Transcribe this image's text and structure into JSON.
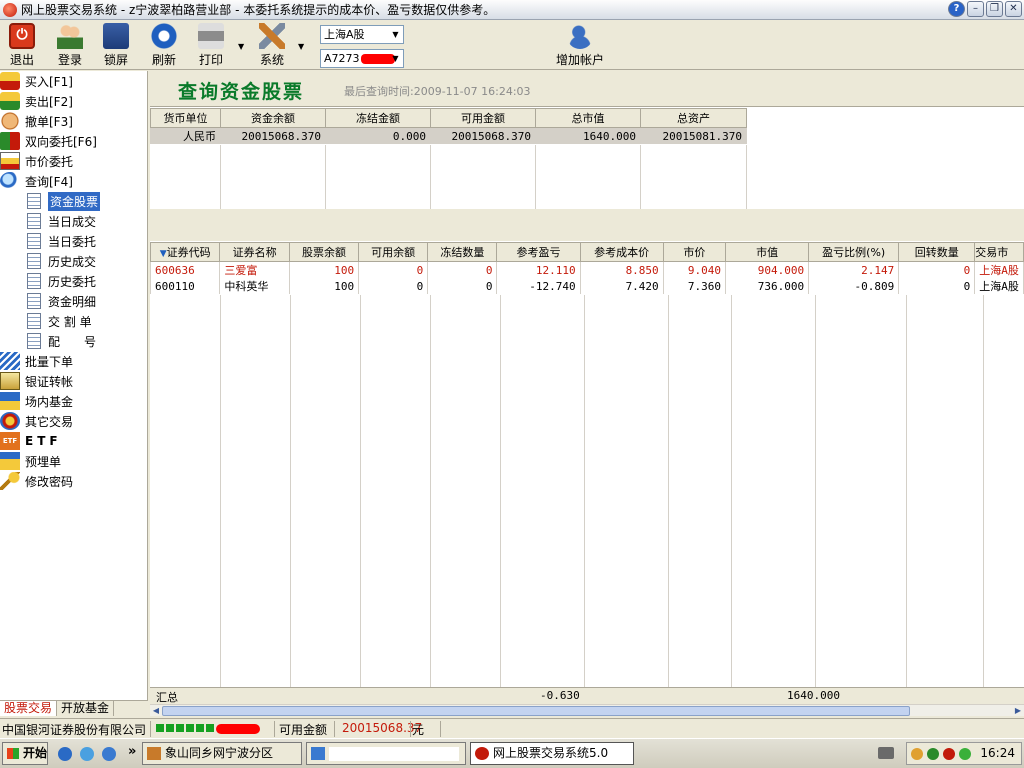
{
  "window": {
    "title": "网上股票交易系统 - z宁波翠柏路营业部 - 本委托系统提示的成本价、盈亏数据仅供参考。",
    "help_label": "?",
    "minimize_label": "–",
    "restore_label": "❐",
    "close_label": "✕"
  },
  "toolbar": {
    "exit": "退出",
    "login": "登录",
    "lock": "锁屏",
    "refresh": "刷新",
    "print": "打印",
    "system": "系统",
    "add_account": "增加帐户",
    "market_select": "上海A股",
    "account_select": "A7273"
  },
  "sidebar": {
    "items": [
      {
        "label": "买入[F1]",
        "icon": "buy-icon"
      },
      {
        "label": "卖出[F2]",
        "icon": "sell-icon"
      },
      {
        "label": "撤单[F3]",
        "icon": "cancel-hand-icon"
      },
      {
        "label": "双向委托[F6]",
        "icon": "dual-order-icon"
      },
      {
        "label": "市价委托",
        "icon": "market-order-icon"
      },
      {
        "label": "查询[F4]",
        "icon": "query-magnifier-icon"
      }
    ],
    "query_subitems": [
      "资金股票",
      "当日成交",
      "当日委托",
      "历史成交",
      "历史委托",
      "资金明细",
      "交 割 单",
      "配　　号"
    ],
    "more_items": [
      {
        "label": "批量下单",
        "icon": "batch-order-icon"
      },
      {
        "label": "银证转帐",
        "icon": "bank-transfer-icon"
      },
      {
        "label": "场内基金",
        "icon": "exchange-fund-icon"
      },
      {
        "label": "其它交易",
        "icon": "other-trade-icon"
      },
      {
        "label": "ETF",
        "icon": "etf-icon",
        "icon_text": "ETF"
      },
      {
        "label": "预埋单",
        "icon": "preorder-icon"
      },
      {
        "label": "修改密码",
        "icon": "key-icon"
      }
    ],
    "tabs": [
      "股票交易",
      "开放基金"
    ]
  },
  "main": {
    "title": "查询资金股票",
    "last_query": "最后查询时间:2009-11-07 16:24:03",
    "funds_table": {
      "headers": [
        "货币单位",
        "资金余额",
        "冻结金额",
        "可用金额",
        "总市值",
        "总资产"
      ],
      "rows": [
        [
          "人民币",
          "20015068.370",
          "0.000",
          "20015068.370",
          "1640.000",
          "20015081.370"
        ]
      ]
    },
    "stock_table": {
      "headers": [
        "证券代码",
        "证券名称",
        "股票余额",
        "可用余额",
        "冻结数量",
        "参考盈亏",
        "参考成本价",
        "市价",
        "市值",
        "盈亏比例(%)",
        "回转数量",
        "交易市"
      ],
      "rows": [
        [
          "600636",
          "三爱富",
          "100",
          "0",
          "0",
          "12.110",
          "8.850",
          "9.040",
          "904.000",
          "2.147",
          "0",
          "上海A股"
        ],
        [
          "600110",
          "中科英华",
          "100",
          "0",
          "0",
          "-12.740",
          "7.420",
          "7.360",
          "736.000",
          "-0.809",
          "0",
          "上海A股"
        ]
      ],
      "totals_label": "汇总",
      "totals_profit": "-0.630",
      "totals_market_value": "1640.000"
    }
  },
  "statusbar": {
    "company": "中国银河证券股份有限公司",
    "available_label": "可用金额",
    "available_value": "20015068.37",
    "unit": "元"
  },
  "taskbar": {
    "start": "开始",
    "task1": "象山同乡网宁波分区",
    "task3": "网上股票交易系统5.0",
    "overflow": "»",
    "clock": "16:24"
  },
  "colors": {
    "title_green": "#0a7a2a",
    "profit_red": "#c41a0a",
    "selection_blue": "#316ac5",
    "status_green": "#16a020"
  }
}
